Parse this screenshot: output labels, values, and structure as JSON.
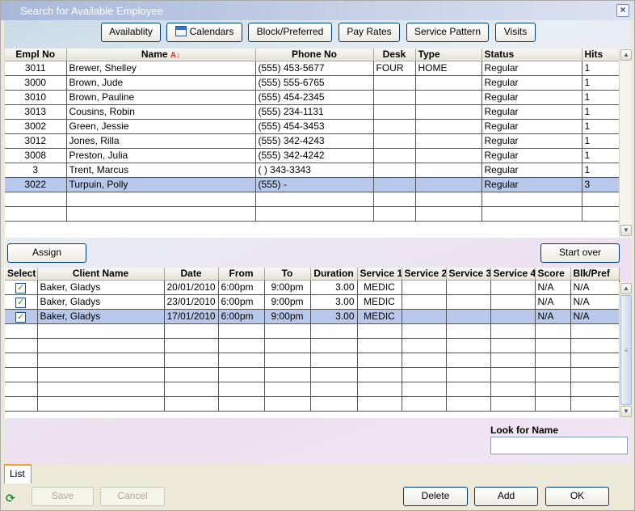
{
  "window": {
    "title": "Search for Available Employee",
    "close_glyph": "×"
  },
  "toolbar": {
    "availability": "Availablity",
    "calendars": "Calendars",
    "block_preferred": "Block/Preferred",
    "pay_rates": "Pay Rates",
    "service_pattern": "Service Pattern",
    "visits": "Visits"
  },
  "employees": {
    "headers": [
      "Empl No",
      "Name",
      "Phone No",
      "Desk",
      "Type",
      "Status",
      "Hits"
    ],
    "sort_indicator": "A↓",
    "rows": [
      [
        "3011",
        "Brewer, Shelley",
        "(555) 453-5677",
        "FOUR",
        "HOME",
        "Regular",
        "1"
      ],
      [
        "3000",
        "Brown, Jude",
        "(555) 555-6765",
        "",
        "",
        "Regular",
        "1"
      ],
      [
        "3010",
        "Brown, Pauline",
        "(555) 454-2345",
        "",
        "",
        "Regular",
        "1"
      ],
      [
        "3013",
        "Cousins, Robin",
        "(555) 234-1131",
        "",
        "",
        "Regular",
        "1"
      ],
      [
        "3002",
        "Green, Jessie",
        "(555) 454-3453",
        "",
        "",
        "Regular",
        "1"
      ],
      [
        "3012",
        "Jones, Rilla",
        "(555) 342-4243",
        "",
        "",
        "Regular",
        "1"
      ],
      [
        "3008",
        "Preston, Julia",
        "(555) 342-4242",
        "",
        "",
        "Regular",
        "1"
      ],
      [
        "3",
        "Trent, Marcus",
        "(   ) 343-3343",
        "",
        "",
        "Regular",
        "1"
      ],
      [
        "3022",
        "Turpuin, Polly",
        "(555)    -",
        "",
        "",
        "Regular",
        "3"
      ]
    ],
    "selected_row": 8
  },
  "actions": {
    "assign": "Assign",
    "start_over": "Start over"
  },
  "visits": {
    "headers": [
      "Select",
      "Client Name",
      "Date",
      "From",
      "To",
      "Duration",
      "Service 1",
      "Service 2",
      "Service 3",
      "Service 4",
      "Score",
      "Blk/Pref"
    ],
    "rows": [
      [
        "✓",
        "Baker, Gladys",
        "20/01/2010",
        "6:00pm",
        "9:00pm",
        "3.00",
        "MEDIC",
        "",
        "",
        "",
        "N/A",
        "N/A"
      ],
      [
        "✓",
        "Baker, Gladys",
        "23/01/2010",
        "6:00pm",
        "9:00pm",
        "3.00",
        "MEDIC",
        "",
        "",
        "",
        "N/A",
        "N/A"
      ],
      [
        "✓",
        "Baker, Gladys",
        "17/01/2010",
        "6:00pm",
        "9:00pm",
        "3.00",
        "MEDIC",
        "",
        "",
        "",
        "N/A",
        "N/A"
      ]
    ],
    "selected_row": 2
  },
  "search": {
    "label": "Look for Name",
    "value": "",
    "placeholder": ""
  },
  "tabs": {
    "list": "List"
  },
  "footer": {
    "save": "Save",
    "cancel": "Cancel",
    "delete": "Delete",
    "add": "Add",
    "ok": "OK"
  },
  "colors": {
    "selection": "#b7c8ea",
    "title_bar": "#a8b8d8",
    "accent_tab": "#f4a12f"
  }
}
